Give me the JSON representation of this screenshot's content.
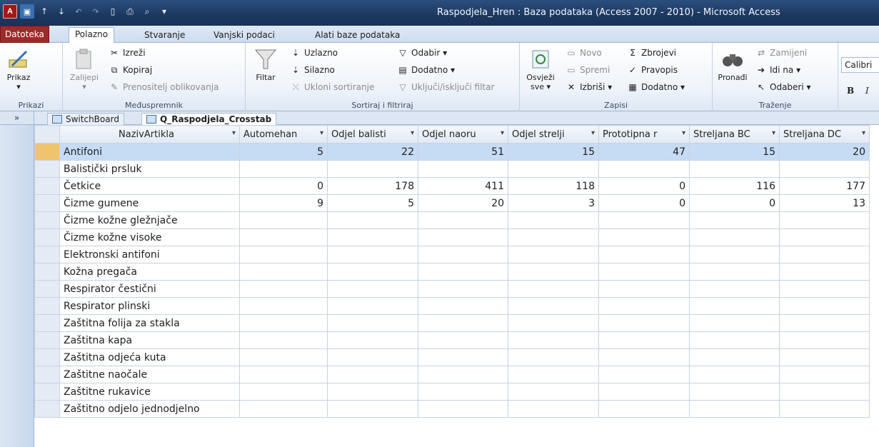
{
  "window": {
    "title": "Raspodjela_Hren : Baza podataka (Access 2007 - 2010)  -  Microsoft Access"
  },
  "quick_access": {
    "app_icon": "A"
  },
  "tabs": [
    "Datoteka",
    "Polazno",
    "Stvaranje",
    "Vanjski podaci",
    "Alati baze podataka"
  ],
  "ribbon": {
    "prikazi": {
      "button": "Prikaz",
      "label": "Prikazi"
    },
    "clipboard": {
      "paste": "Zalijepi",
      "cut": "Izreži",
      "copy": "Kopiraj",
      "format_painter": "Prenositelj oblikovanja",
      "label": "Međuspremnik"
    },
    "sort_filter": {
      "filter": "Filtar",
      "asc": "Uzlazno",
      "desc": "Silazno",
      "remove_sort": "Ukloni sortiranje",
      "selection": "Odabir ▾",
      "advanced": "Dodatno ▾",
      "toggle_filter": "Uključi/isključi filtar",
      "label": "Sortiraj i filtriraj"
    },
    "records": {
      "refresh": "Osvježi",
      "refresh2": "sve ▾",
      "new": "Novo",
      "save": "Spremi",
      "delete": "Izbriši ▾",
      "totals": "Zbrojevi",
      "spelling": "Pravopis",
      "more": "Dodatno ▾",
      "label": "Zapisi"
    },
    "find": {
      "find": "Pronađi",
      "replace": "Zamijeni",
      "goto": "Idi na ▾",
      "select": "Odaberi ▾",
      "label": "Traženje"
    },
    "text": {
      "font": "Calibri",
      "bold": "B",
      "italic": "I"
    }
  },
  "nav": {
    "toggle": "»"
  },
  "doc_tabs": [
    "SwitchBoard",
    "Q_Raspodjela_Crosstab"
  ],
  "datasheet": {
    "columns": [
      "NazivArtikla",
      "Automehan",
      "Odjel balisti",
      "Odjel naoru",
      "Odjel strelji",
      "Prototipna r",
      "Streljana BC",
      "Streljana DC"
    ],
    "rows": [
      [
        "Antifoni",
        "5",
        "22",
        "51",
        "15",
        "47",
        "15",
        "20"
      ],
      [
        "Balistički prsluk",
        "",
        "",
        "",
        "",
        "",
        "",
        ""
      ],
      [
        "Četkice",
        "0",
        "178",
        "411",
        "118",
        "0",
        "116",
        "177"
      ],
      [
        "Čizme gumene",
        "9",
        "5",
        "20",
        "3",
        "0",
        "0",
        "13"
      ],
      [
        "Čizme kožne gležnjače",
        "",
        "",
        "",
        "",
        "",
        "",
        ""
      ],
      [
        "Čizme kožne visoke",
        "",
        "",
        "",
        "",
        "",
        "",
        ""
      ],
      [
        "Elektronski antifoni",
        "",
        "",
        "",
        "",
        "",
        "",
        ""
      ],
      [
        "Kožna pregača",
        "",
        "",
        "",
        "",
        "",
        "",
        ""
      ],
      [
        "Respirator čestični",
        "",
        "",
        "",
        "",
        "",
        "",
        ""
      ],
      [
        "Respirator plinski",
        "",
        "",
        "",
        "",
        "",
        "",
        ""
      ],
      [
        "Zaštitna folija za stakla",
        "",
        "",
        "",
        "",
        "",
        "",
        ""
      ],
      [
        "Zaštitna kapa",
        "",
        "",
        "",
        "",
        "",
        "",
        ""
      ],
      [
        "Zaštitna odjeća kuta",
        "",
        "",
        "",
        "",
        "",
        "",
        ""
      ],
      [
        "Zaštitne naočale",
        "",
        "",
        "",
        "",
        "",
        "",
        ""
      ],
      [
        "Zaštitne rukavice",
        "",
        "",
        "",
        "",
        "",
        "",
        ""
      ],
      [
        "Zaštitno odjelo jednodjelno",
        "",
        "",
        "",
        "",
        "",
        "",
        ""
      ]
    ],
    "selected_row": 0
  }
}
